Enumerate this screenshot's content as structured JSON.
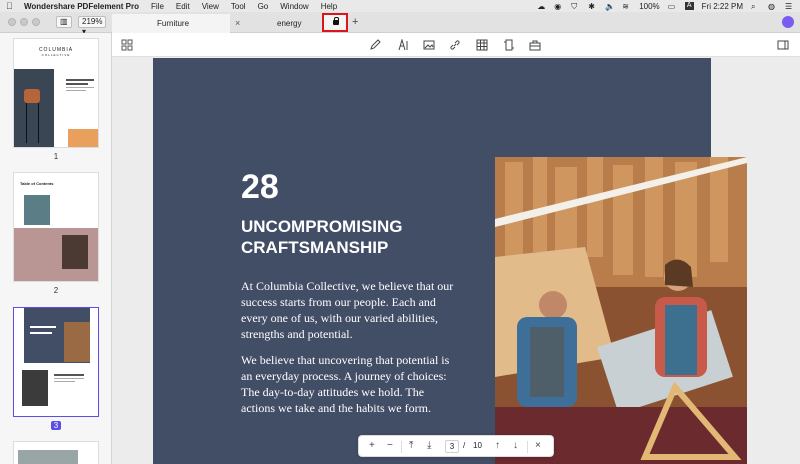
{
  "menubar": {
    "app_name": "Wondershare PDFelement Pro",
    "menus": [
      "File",
      "Edit",
      "View",
      "Tool",
      "Go",
      "Window",
      "Help"
    ],
    "battery": "100%",
    "clock": "Fri 2:22 PM"
  },
  "tabbar": {
    "zoom": "219%",
    "tabs": [
      {
        "label": "Furniture"
      },
      {
        "label": "energy"
      }
    ]
  },
  "sidebar": {
    "pages": [
      {
        "number": "1",
        "title": "COLUMBIA",
        "subtitle": "COLLECTIVE"
      },
      {
        "number": "2",
        "title": "Table of Contents"
      },
      {
        "number": "3",
        "heading": "UNCOMPROMISING CRAFTSMANSHIP"
      }
    ],
    "selected_page": "3"
  },
  "document": {
    "number": "28",
    "heading": "UNCOMPROMISING CRAFTSMANSHIP",
    "paragraph1": "At Columbia Collective, we believe that our success starts from our people. Each and every one of us, with our varied abilities, strengths and potential.",
    "paragraph2": "We believe that uncovering that potential is an everyday process. A journey of choices: The day-to-day attitudes we hold. The actions we take and the habits we form."
  },
  "navbar": {
    "current_page": "3",
    "separator": "/",
    "total_pages": "10"
  },
  "colors": {
    "page_bg": "#424d66",
    "accent": "#5b4de8",
    "highlight": "#d9161b"
  }
}
